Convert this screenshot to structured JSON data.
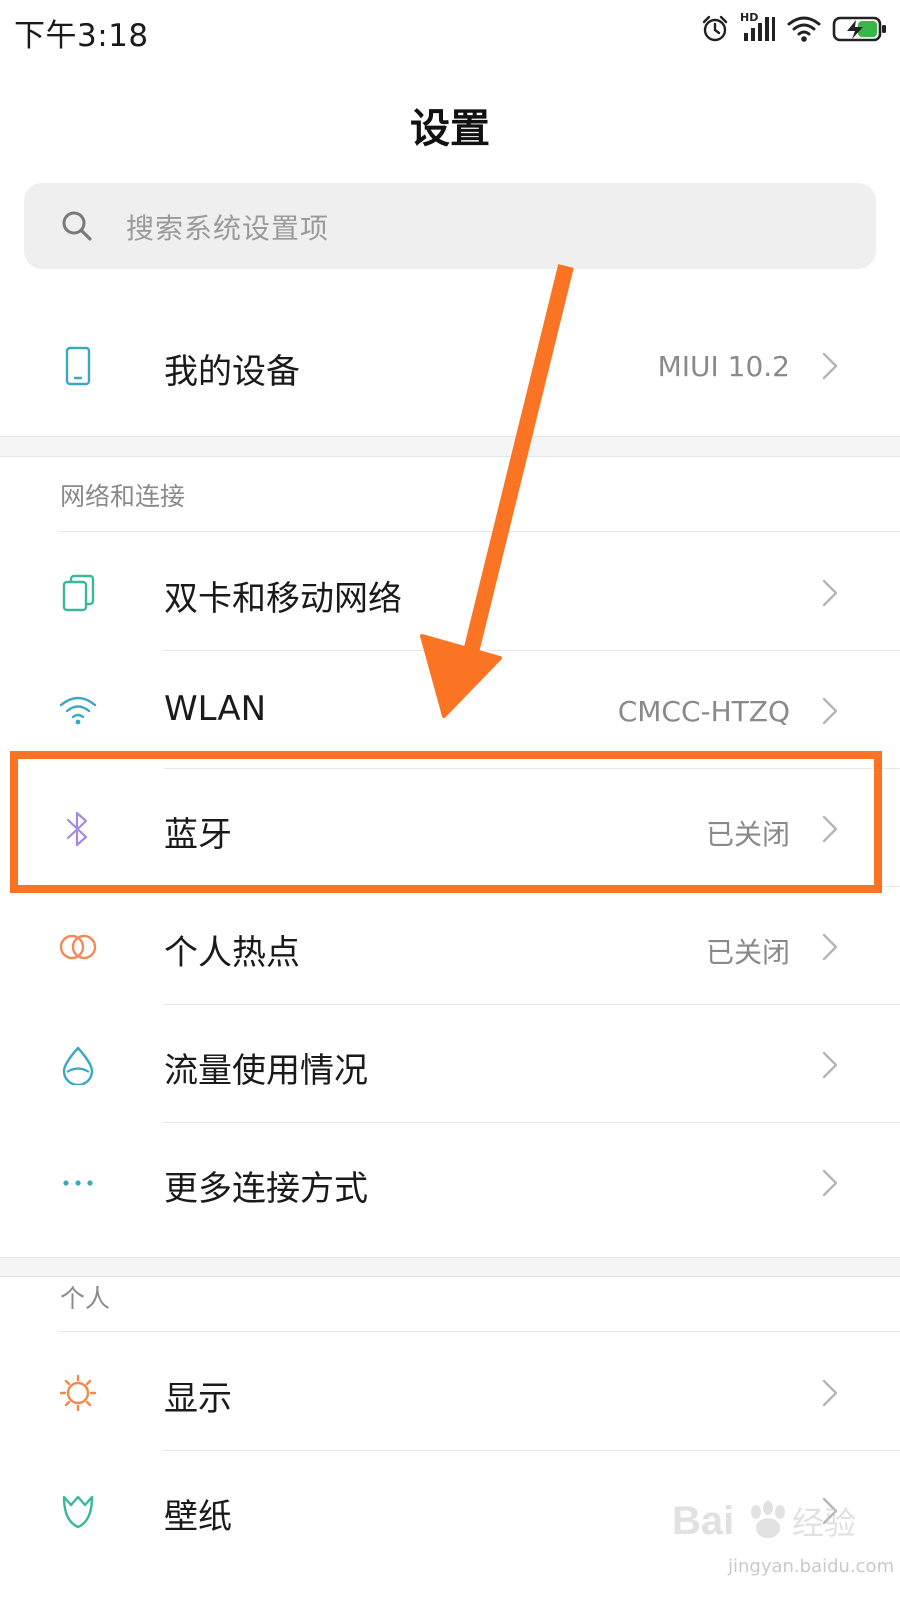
{
  "status_bar": {
    "time": "下午3:18",
    "network_badge": "HD",
    "icons": [
      "alarm-icon",
      "hd-signal-icon",
      "wifi-icon",
      "battery-charging-icon"
    ]
  },
  "header": {
    "title": "设置"
  },
  "search": {
    "placeholder": "搜索系统设置项",
    "icon": "search-icon"
  },
  "device_section": {
    "items": [
      {
        "label": "我的设备",
        "value": "MIUI 10.2",
        "icon": "phone-icon"
      }
    ]
  },
  "network_section": {
    "header": "网络和连接",
    "items": [
      {
        "label": "双卡和移动网络",
        "value": "",
        "icon": "dual-sim-icon"
      },
      {
        "label": "WLAN",
        "value": "CMCC-HTZQ",
        "icon": "wifi-icon"
      },
      {
        "label": "蓝牙",
        "value": "已关闭",
        "icon": "bluetooth-icon"
      },
      {
        "label": "个人热点",
        "value": "已关闭",
        "icon": "hotspot-icon"
      },
      {
        "label": "流量使用情况",
        "value": "",
        "icon": "data-usage-icon"
      },
      {
        "label": "更多连接方式",
        "value": "",
        "icon": "more-connections-icon"
      }
    ]
  },
  "personal_section": {
    "header": "个人",
    "items": [
      {
        "label": "显示",
        "value": "",
        "icon": "display-icon"
      },
      {
        "label": "壁纸",
        "value": "",
        "icon": "wallpaper-icon"
      }
    ]
  },
  "annotation": {
    "highlight_color": "#fa7424",
    "highlighted_item": "蓝牙"
  },
  "watermark": {
    "logo_text": "Bai经验",
    "url": "jingyan.baidu.com"
  },
  "colors": {
    "accent_teal": "#3aa8c4",
    "bluetooth_purple": "#a48be0",
    "hotspot_orange": "#f28a5a",
    "wallpaper_green": "#3ab89a",
    "display_orange": "#f08a4a"
  }
}
